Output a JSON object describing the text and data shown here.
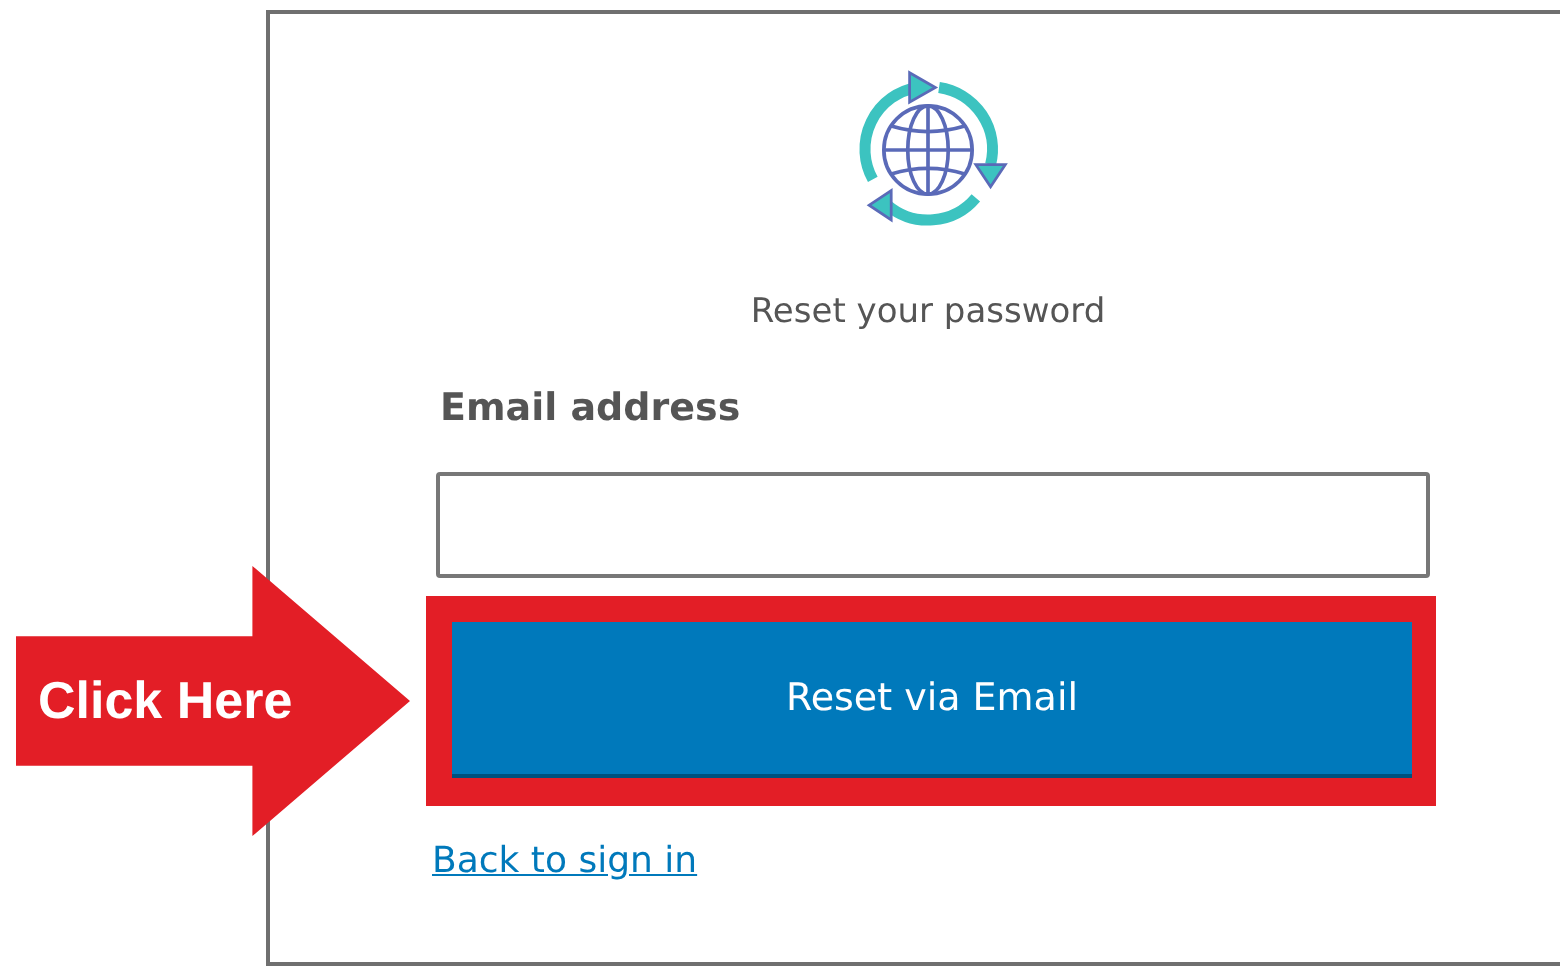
{
  "card": {
    "title": "Reset your password",
    "email_label": "Email address",
    "button": "Reset via Email",
    "back_link": "Back to sign in"
  },
  "callout": {
    "label": "Click Here"
  }
}
